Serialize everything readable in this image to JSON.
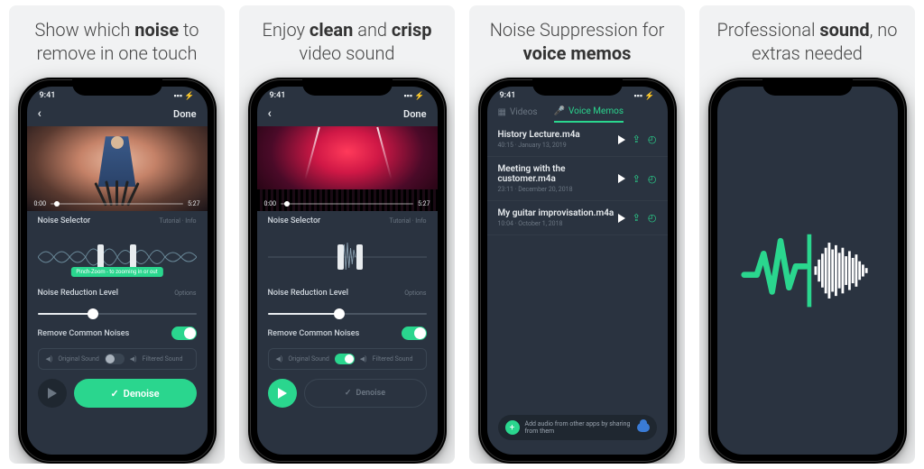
{
  "captions": {
    "s1_a": "Show which ",
    "s1_b": "noise",
    "s1_c": " to remove in one touch",
    "s2_a": "Enjoy ",
    "s2_b": "clean",
    "s2_c": " and ",
    "s2_d": "crisp",
    "s2_e": " video sound",
    "s3_a": "Noise Suppression for ",
    "s3_b": "voice memos",
    "s4_a": "Professional ",
    "s4_b": "sound",
    "s4_c": ", no extras needed"
  },
  "status": {
    "time": "9:41"
  },
  "editor": {
    "back": "‹",
    "done": "Done",
    "clip_start": "0:00",
    "clip_end": "5:27",
    "noise_selector": "Noise Selector",
    "tutorial": "Tutorial",
    "info": "Info",
    "tip": "Pinch-Zoom - to zooming in or out",
    "reduction": "Noise Reduction Level",
    "options": "Options",
    "remove_common": "Remove Common Noises",
    "original": "Original Sound",
    "filtered": "Filtered Sound",
    "denoise": "Denoise"
  },
  "memos": {
    "tab_videos": "Videos",
    "tab_memos": "Voice Memos",
    "items": [
      {
        "title": "History Lecture.m4a",
        "dur": "40:15",
        "date": "January 13, 2019"
      },
      {
        "title": "Meeting with the customer.m4a",
        "dur": "23:11",
        "date": "December 20, 2018"
      },
      {
        "title": "My guitar improvisation.m4a",
        "dur": "10:04",
        "date": "October 1, 2018"
      }
    ],
    "hint": "Add audio from other apps by sharing from them"
  }
}
